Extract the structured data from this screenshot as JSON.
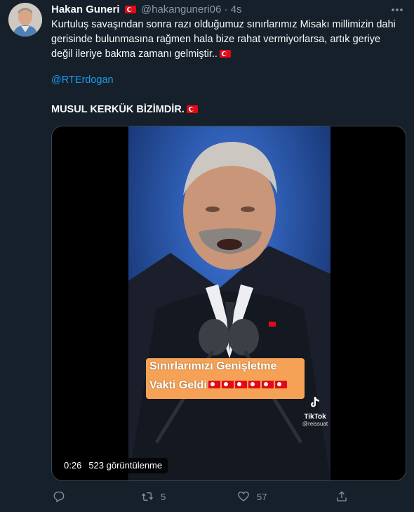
{
  "author": {
    "display_name": "Hakan Guneri",
    "handle": "@hakanguneri06",
    "separator": "·",
    "time": "4s"
  },
  "tweet": {
    "text": "Kurtuluş savaşından sonra razı olduğumuz sınırlarımız Misakı  millimizin dahi gerisinde bulunmasına rağmen hala bize rahat vermiyorlarsa, artık geriye değil ileriye bakma zamanı gelmiştir..",
    "mention": "@RTErdogan",
    "tagline": "MUSUL KERKÜK BİZİMDİR."
  },
  "media": {
    "caption_line1": "Sınırlarımızı Genişletme",
    "caption_line2": "Vakti Geldi",
    "tiktok_label": "TikTok",
    "tiktok_user": "@reissuat",
    "duration": "0:26",
    "views": "523 görüntülenme"
  },
  "actions": {
    "reply_count": "",
    "retweet_count": "5",
    "like_count": "57"
  },
  "colors": {
    "background": "#15202b",
    "link": "#1d9bf0",
    "muted": "#8b98a5",
    "flag_red": "#e30a17",
    "caption_orange": "#f5a256"
  }
}
